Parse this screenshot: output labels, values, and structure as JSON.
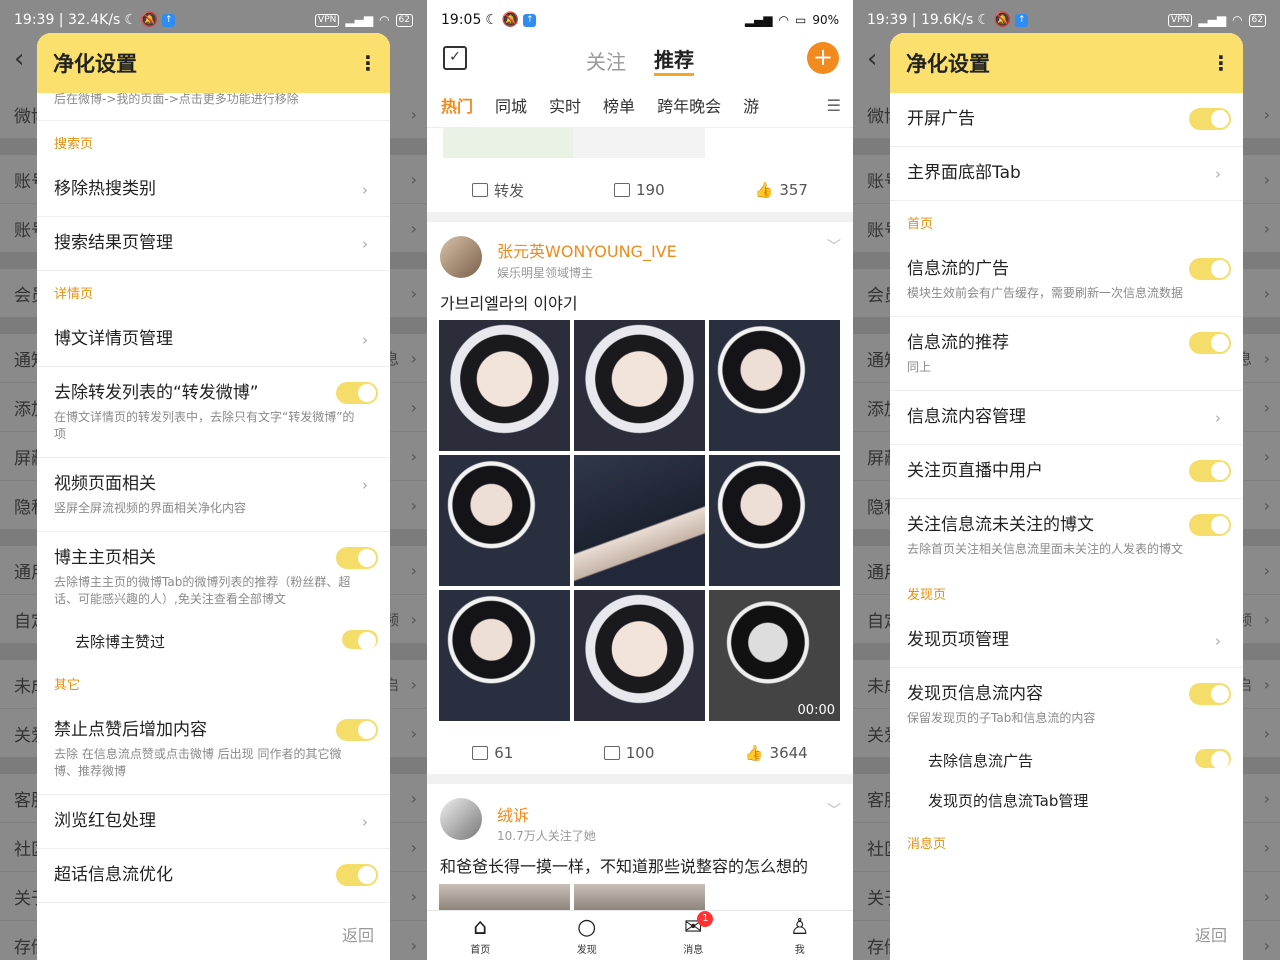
{
  "left": {
    "status": {
      "time": "19:39 | 32.4K/s",
      "vpn": "VPN",
      "battery": "62"
    },
    "bg_rows": [
      {
        "label": "微博",
        "right": ""
      },
      {
        "label": "账号",
        "right": ""
      },
      {
        "label": "账号",
        "right": ""
      },
      {
        "label": "会员",
        "right": ""
      },
      {
        "label": "通知",
        "right": "息"
      },
      {
        "label": "添加",
        "right": ""
      },
      {
        "label": "屏蔽",
        "right": ""
      },
      {
        "label": "隐私",
        "right": ""
      },
      {
        "label": "通用",
        "right": ""
      },
      {
        "label": "自定",
        "right": "频"
      },
      {
        "label": "未成",
        "right": "启"
      },
      {
        "label": "关爱",
        "right": ""
      },
      {
        "label": "客服",
        "right": ""
      },
      {
        "label": "社区",
        "right": ""
      },
      {
        "label": "关于",
        "right": ""
      },
      {
        "label": "存储",
        "right": ""
      }
    ],
    "dialog": {
      "title": "净化设置",
      "top_note": "后在微博->我的页面->点击更多功能进行移除",
      "sec_search": "搜索页",
      "i1": "移除热搜类别",
      "i2": "搜索结果页管理",
      "sec_detail": "详情页",
      "i3": "博文详情页管理",
      "i4": "去除转发列表的“转发微博”",
      "i4d": "在博文详情页的转发列表中，去除只有文字“转发微博”的项",
      "i5": "视频页面相关",
      "i5d": "竖屏全屏流视频的界面相关净化内容",
      "i6": "博主主页相关",
      "i6d": "去除博主主页的微博Tab的微博列表的推荐（粉丝群、超话、可能感兴趣的人）,免关注查看全部博文",
      "i7": "去除博主赞过",
      "sec_other": "其它",
      "i8": "禁止点赞后增加内容",
      "i8d": "去除 在信息流点赞或点击微博 后出现 同作者的其它微博、推荐微博",
      "i9": "浏览红包处理",
      "i10": "超话信息流优化",
      "back": "返回"
    }
  },
  "middle": {
    "status": {
      "time": "19:05",
      "battery": "90%"
    },
    "tabs": [
      "关注",
      "推荐"
    ],
    "channels": [
      "热门",
      "同城",
      "实时",
      "榜单",
      "跨年晚会",
      "游"
    ],
    "post0": {
      "repost": "转发",
      "comments": "190",
      "likes": "357"
    },
    "post1": {
      "name": "张元英WONYOUNG_IVE",
      "meta": "娱乐明星领域博主",
      "text": "가브리엘라의 이야기",
      "video_time": "00:00",
      "reposts": "61",
      "comments": "100",
      "likes": "3644"
    },
    "post2": {
      "name": "绒诉",
      "meta": "10.7万人关注了她",
      "text": "和爸爸长得一摸一样，不知道那些说整容的怎么想的"
    },
    "tabbar": [
      "首页",
      "发现",
      "消息",
      "我"
    ],
    "badge": "1"
  },
  "right": {
    "status": {
      "time": "19:39 | 19.6K/s",
      "vpn": "VPN",
      "battery": "62"
    },
    "dialog": {
      "title": "净化设置",
      "i1": "开屏广告",
      "i2": "主界面底部Tab",
      "sec_home": "首页",
      "i3": "信息流的广告",
      "i3d": "模块生效前会有广告缓存，需要刷新一次信息流数据",
      "i4": "信息流的推荐",
      "i4d": "同上",
      "i5": "信息流内容管理",
      "i6": "关注页直播中用户",
      "i7": "关注信息流未关注的博文",
      "i7d": "去除首页关注相关信息流里面未关注的人发表的博文",
      "sec_discover": "发现页",
      "i8": "发现页项管理",
      "i9": "发现页信息流内容",
      "i9d": "保留发现页的子Tab和信息流的内容",
      "i10": "去除信息流广告",
      "i11": "发现页的信息流Tab管理",
      "sec_msg": "消息页",
      "back": "返回"
    }
  }
}
